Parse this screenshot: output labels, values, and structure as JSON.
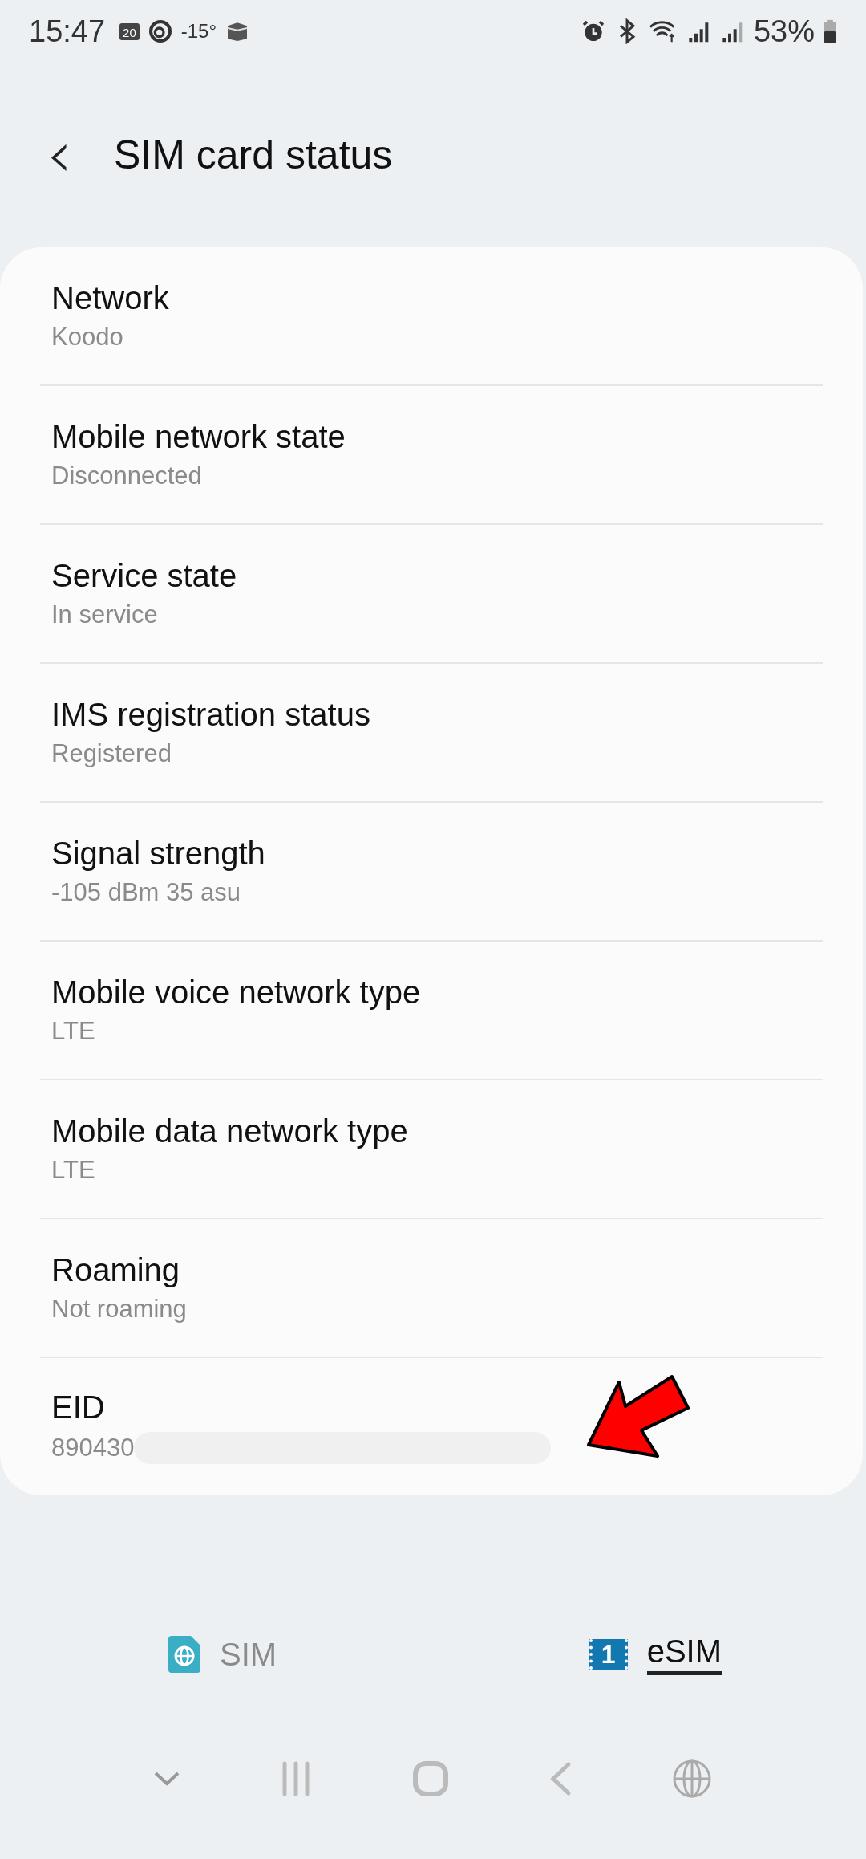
{
  "status_bar": {
    "time": "15:47",
    "calendar_day": "20",
    "temperature": "-15°",
    "battery": "53%"
  },
  "header": {
    "back": "‹",
    "title": "SIM card status"
  },
  "items": [
    {
      "title": "Network",
      "value": "Koodo"
    },
    {
      "title": "Mobile network state",
      "value": "Disconnected"
    },
    {
      "title": "Service state",
      "value": "In service"
    },
    {
      "title": "IMS registration status",
      "value": "Registered"
    },
    {
      "title": "Signal strength",
      "value": "-105 dBm 35 asu"
    },
    {
      "title": "Mobile voice network type",
      "value": "LTE"
    },
    {
      "title": "Mobile data network type",
      "value": "LTE"
    },
    {
      "title": "Roaming",
      "value": "Not roaming"
    },
    {
      "title": "EID",
      "value": "890430",
      "redacted": true
    }
  ],
  "tabs": [
    {
      "label": "SIM",
      "kind": "sim",
      "selected": false
    },
    {
      "label": "eSIM",
      "kind": "esim",
      "icon_text": "1",
      "selected": true
    }
  ]
}
